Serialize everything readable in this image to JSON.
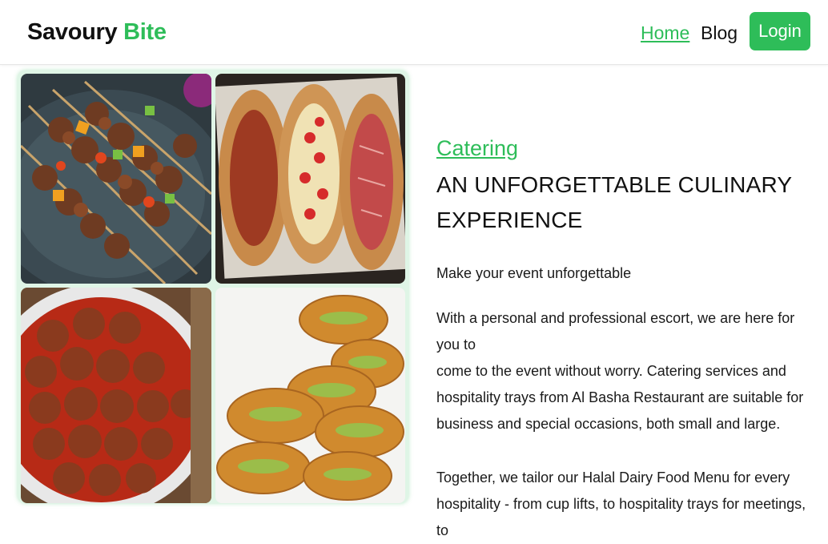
{
  "header": {
    "brand_part1": "Savoury",
    "brand_part2": "Bite",
    "nav": [
      {
        "label": "Home",
        "active": true
      },
      {
        "label": "Blog",
        "active": false
      }
    ],
    "login_label": "Login"
  },
  "gallery": {
    "images": [
      {
        "icon": "kebab-skewers-image"
      },
      {
        "icon": "pide-flatbread-image"
      },
      {
        "icon": "meatballs-tomato-sauce-image"
      },
      {
        "icon": "pistachio-pastries-image"
      }
    ]
  },
  "main": {
    "kicker": "Catering",
    "headline_line1": "AN UNFORGETTABLE CULINARY",
    "headline_line2": "EXPERIENCE",
    "tagline": "Make your event unforgettable",
    "para1_line1": "With a personal and professional escort, we are here for you to",
    "para1_line2": "come to the event without worry. Catering services and",
    "para1_line3": "hospitality trays from Al Basha Restaurant are suitable for",
    "para1_line4": "business and special occasions, both small and large.",
    "para2_line1": "Together, we tailor our Halal Dairy Food Menu for every",
    "para2_line2": "hospitality - from cup lifts, to hospitality trays for meetings, to"
  },
  "colors": {
    "accent": "#2ebd59",
    "text": "#111111"
  }
}
